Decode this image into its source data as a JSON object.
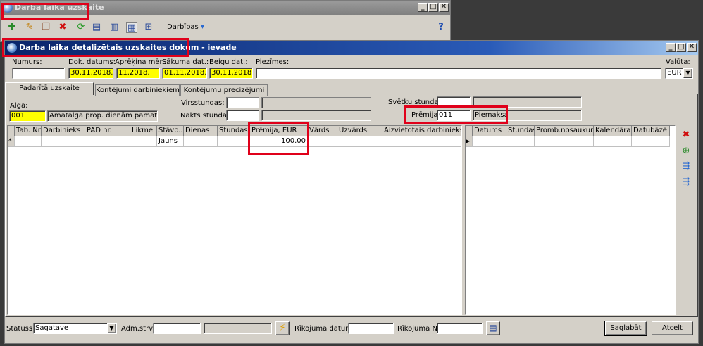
{
  "back_window": {
    "title": "Darba laika uzskaite",
    "toolbar": {
      "actions_label": "Darbības",
      "icons": [
        "add-icon",
        "edit-icon",
        "copy-icon",
        "delete-icon",
        "refresh-icon",
        "print-icon",
        "columns-icon",
        "grid-view-icon",
        "tree-icon",
        "help-icon"
      ]
    },
    "caption_buttons": {
      "min": "_",
      "max": "□",
      "close": "✕"
    }
  },
  "main_window": {
    "title": "Darba laika detalizētais uzskaites dokum - ievade",
    "caption_buttons": {
      "min": "_",
      "max": "□",
      "close": "✕"
    },
    "header": {
      "numurs_label": "Numurs:",
      "numurs_value": "",
      "dok_datums_label": "Dok. datums:",
      "dok_datums_value": "30.11.2018.",
      "aprekina_men_label": "Aprēķina mēn.:",
      "aprekina_men_value": "11.2018.",
      "sakuma_dat_label": "Sākuma dat.:",
      "sakuma_dat_value": "01.11.2018.",
      "beigu_dat_label": "Beigu dat.:",
      "beigu_dat_value": "30.11.2018.",
      "piezimes_label": "Piezīmes:",
      "piezimes_value": "",
      "valuta_label": "Valūta:",
      "valuta_value": "EUR"
    },
    "tabs": [
      {
        "label": "Padarītā uzskaite",
        "active": true
      },
      {
        "label": "Kontējumi darbiniekiem",
        "active": false
      },
      {
        "label": "Kontējumu precizējumi",
        "active": false
      }
    ],
    "form": {
      "alga_label": "Alga:",
      "alga_code": "001",
      "alga_name": "Amatalga prop. dienām pamatslodzē",
      "virsstundas_label": "Virsstundas:",
      "virsstundas_code": "",
      "virsstundas_name": "",
      "nakts_label": "Nakts stundas:",
      "nakts_code": "",
      "nakts_name": "",
      "svetku_label": "Svētku stundas:",
      "svetku_code": "",
      "svetku_name": "",
      "premija_label": "Prēmija:",
      "premija_code": "011",
      "premija_name": "Piemaksa"
    },
    "left_grid": {
      "columns": [
        "Tab. Nr.",
        "Darbinieks",
        "PAD nr.",
        "Likme",
        "Stāvo...",
        "Dienas",
        "Stundas",
        "Prēmija, EUR",
        "Vārds",
        "Uzvārds",
        "Aizvietotais darbinieks"
      ],
      "row_marker": "*",
      "row": [
        "",
        "",
        "",
        "",
        "Jauns",
        "",
        "",
        "100.00",
        "",
        "",
        ""
      ]
    },
    "right_grid": {
      "columns": [
        "Datums",
        "Stundas",
        "Promb.nosaukums",
        "Kalendāra...",
        "Datubāzē ..."
      ],
      "row_marker": "▶"
    },
    "side_icons": [
      "delete-row-icon",
      "add-row-icon",
      "import-icon",
      "export-icon"
    ],
    "footer": {
      "statuss_label": "Statuss:",
      "statuss_value": "Sagatave",
      "adm_label": "Adm.strv:",
      "adm_value": "",
      "adm_name": "",
      "rik_datums_label": "Rīkojuma datums:",
      "rik_datums_value": "",
      "rik_nr_label": "Rīkojuma Nr:",
      "rik_nr_value": "",
      "save_label": "Saglabāt",
      "cancel_label": "Atcelt"
    }
  },
  "colors": {
    "highlight_box": "#e0001a",
    "required_field": "#ffff00",
    "active_title": "#0a246a",
    "window_face": "#d4d0c8"
  }
}
